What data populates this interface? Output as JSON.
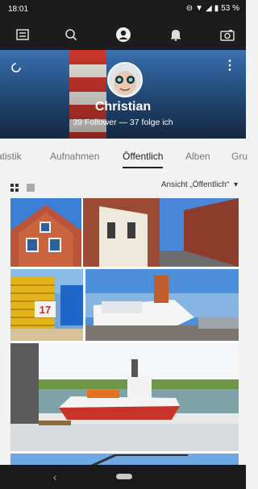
{
  "status_bar": {
    "time": "18:01",
    "battery": "53 %"
  },
  "toolbar": {
    "icons": [
      "gallery-icon",
      "search-icon",
      "profile-icon",
      "bell-icon",
      "camera-icon"
    ]
  },
  "profile": {
    "name": "Christian",
    "stats": "39 Follower — 37 folge ich"
  },
  "tabs": [
    {
      "label": "atistik"
    },
    {
      "label": "Aufnahmen"
    },
    {
      "label": "Öffentlich",
      "active": true
    },
    {
      "label": "Alben"
    },
    {
      "label": "Gru"
    }
  ],
  "filter": {
    "view_label": "Ansicht „Öffentlich“",
    "dropdown_arrow": "▾"
  },
  "photos": [
    {
      "subject": "brick-house"
    },
    {
      "subject": "brick-street"
    },
    {
      "subject": "beach-chair",
      "number": "17"
    },
    {
      "subject": "harbor-ship"
    },
    {
      "subject": "rescue-boat"
    },
    {
      "subject": "crane"
    }
  ],
  "colors": {
    "accent": "#222222",
    "status_bar": "#1a1a1a",
    "toolbar": "#1d1d1d",
    "background": "#f2f2f2"
  }
}
